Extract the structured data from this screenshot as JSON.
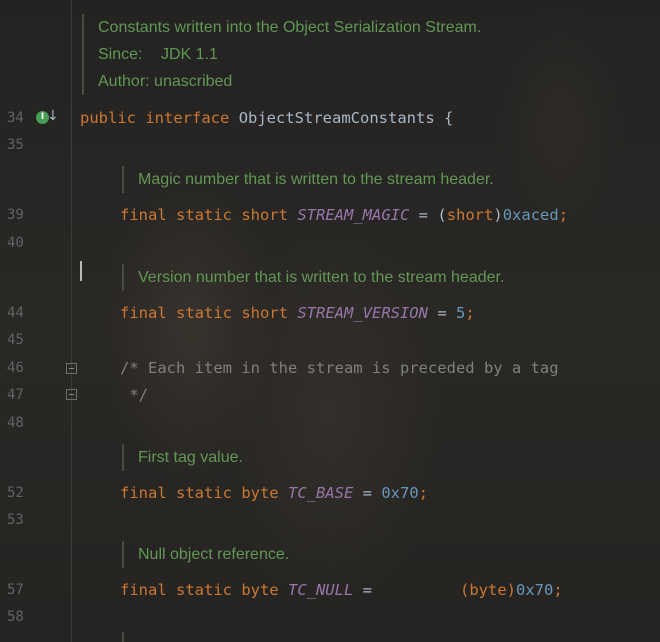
{
  "top_doc": {
    "description": "Constants written into the Object Serialization Stream.",
    "since_label": "Since:",
    "since_value": "JDK 1.1",
    "author_label": "Author:",
    "author_value": "unascribed"
  },
  "line_numbers": [
    "34",
    "35",
    "39",
    "40",
    "44",
    "45",
    "46",
    "47",
    "48",
    "52",
    "53",
    "57",
    "58"
  ],
  "interface_decl": {
    "modifier": "public",
    "keyword": "interface",
    "name": "ObjectStreamConstants",
    "brace": "{"
  },
  "docs": {
    "magic": "Magic number that is written to the stream header.",
    "version": "Version number that is written to the stream header.",
    "tc_base": "First tag value.",
    "tc_null": "Null object reference."
  },
  "stream_magic": {
    "mods": "final static short",
    "name": "STREAM_MAGIC",
    "eq": "=",
    "cast_open": "(",
    "cast_type": "short",
    "cast_close": ")",
    "value": "0xaced",
    "semi": ";"
  },
  "stream_version": {
    "mods": "final static short",
    "name": "STREAM_VERSION",
    "eq": "=",
    "value": "5",
    "semi": ";"
  },
  "block_comment": {
    "line1": "/* Each item in the stream is preceded by a tag",
    "line2": " */"
  },
  "tc_base": {
    "mods": "final static byte",
    "name": "TC_BASE",
    "eq": "=",
    "value": "0x70",
    "semi": ";"
  },
  "tc_null": {
    "mods": "final static byte",
    "name": "TC_NULL",
    "eq": "=",
    "cast": "(byte)",
    "value": "0x70",
    "semi": ";"
  },
  "gutter": {
    "implemented_icon": "I"
  },
  "colors": {
    "background": "#262625",
    "keyword": "#cc7832",
    "constant": "#9876aa",
    "number": "#6897bb",
    "doc_text": "#629755",
    "plain": "#a9b7c6",
    "comment": "#808080",
    "line_number": "#606366"
  }
}
